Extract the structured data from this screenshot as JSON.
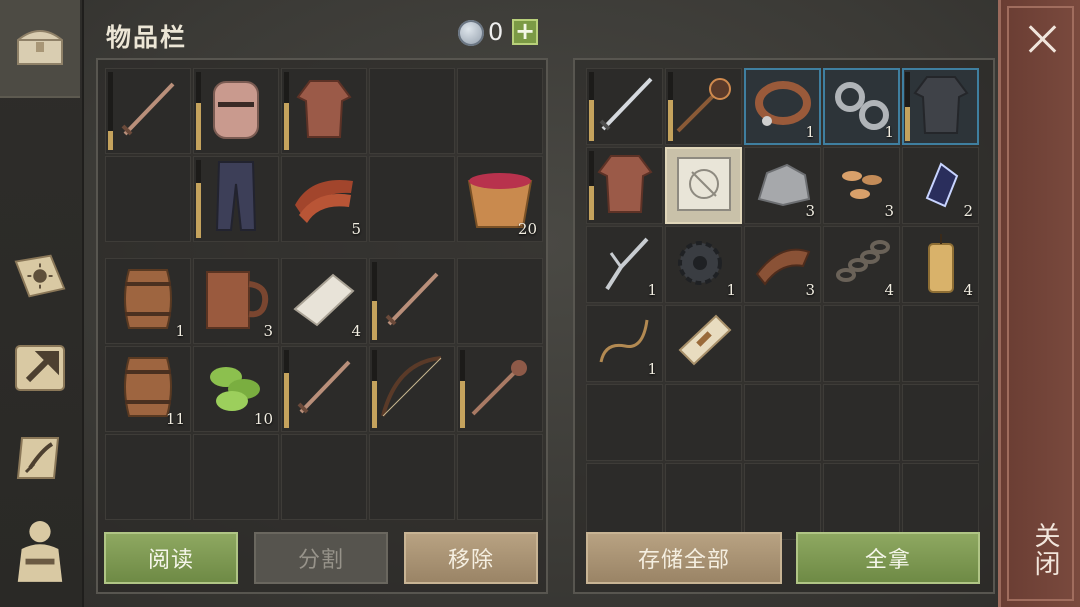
{
  "header": {
    "title": "物品栏",
    "currency": "0",
    "add": "+"
  },
  "inventory": {
    "top": [
      {
        "icon": "sword-icon",
        "qty": "",
        "dur": 0.25
      },
      {
        "icon": "knight-helmet-icon",
        "qty": "",
        "dur": 0.6
      },
      {
        "icon": "chainmail-shirt-icon",
        "qty": "",
        "dur": 0.6
      },
      {
        "icon": "",
        "qty": ""
      },
      {
        "icon": "",
        "qty": ""
      },
      {
        "icon": "",
        "qty": ""
      },
      {
        "icon": "pants-icon",
        "qty": "",
        "dur": 0.7
      },
      {
        "icon": "raw-meat-icon",
        "qty": "5"
      },
      {
        "icon": "",
        "qty": ""
      },
      {
        "icon": "berry-bucket-icon",
        "qty": "20"
      }
    ],
    "bottom": [
      {
        "icon": "barrel-icon",
        "qty": "1"
      },
      {
        "icon": "wooden-mug-icon",
        "qty": "3"
      },
      {
        "icon": "bandage-roll-icon",
        "qty": "4"
      },
      {
        "icon": "sword-icon",
        "qty": "",
        "dur": 0.5
      },
      {
        "icon": "",
        "qty": ""
      },
      {
        "icon": "barrel-icon",
        "qty": "11"
      },
      {
        "icon": "green-herb-icon",
        "qty": "10"
      },
      {
        "icon": "sword-icon",
        "qty": "",
        "dur": 0.7
      },
      {
        "icon": "bow-icon",
        "qty": "",
        "dur": 0.6
      },
      {
        "icon": "mace-icon",
        "qty": "",
        "dur": 0.6
      },
      {
        "icon": "",
        "qty": ""
      },
      {
        "icon": "",
        "qty": ""
      },
      {
        "icon": "",
        "qty": ""
      },
      {
        "icon": "",
        "qty": ""
      },
      {
        "icon": "",
        "qty": ""
      }
    ]
  },
  "storage": [
    {
      "icon": "steel-sword-icon",
      "qty": "",
      "dur": 0.6
    },
    {
      "icon": "spiked-mace-icon",
      "qty": "",
      "dur": 0.6
    },
    {
      "icon": "leather-collar-icon",
      "qty": "1",
      "highlight": true
    },
    {
      "icon": "shackles-icon",
      "qty": "1",
      "highlight": true
    },
    {
      "icon": "plate-armor-icon",
      "qty": "",
      "highlight": true,
      "dur": 0.5
    },
    {
      "icon": "chainmail-shirt-icon",
      "qty": "",
      "dur": 0.5
    },
    {
      "icon": "blueprint-icon",
      "qty": "",
      "selected": true
    },
    {
      "icon": "stone-icon",
      "qty": "3"
    },
    {
      "icon": "seeds-icon",
      "qty": "3"
    },
    {
      "icon": "crystal-icon",
      "qty": "2"
    },
    {
      "icon": "hook-icon",
      "qty": "1"
    },
    {
      "icon": "gear-icon",
      "qty": "1"
    },
    {
      "icon": "leather-icon",
      "qty": "3"
    },
    {
      "icon": "chain-icon",
      "qty": "4"
    },
    {
      "icon": "candle-icon",
      "qty": "4"
    },
    {
      "icon": "rope-icon",
      "qty": "1"
    },
    {
      "icon": "scroll-bundle-icon",
      "qty": ""
    },
    {
      "icon": "",
      "qty": ""
    },
    {
      "icon": "",
      "qty": ""
    },
    {
      "icon": "",
      "qty": ""
    },
    {
      "icon": "",
      "qty": ""
    },
    {
      "icon": "",
      "qty": ""
    },
    {
      "icon": "",
      "qty": ""
    },
    {
      "icon": "",
      "qty": ""
    },
    {
      "icon": "",
      "qty": ""
    },
    {
      "icon": "",
      "qty": ""
    },
    {
      "icon": "",
      "qty": ""
    },
    {
      "icon": "",
      "qty": ""
    },
    {
      "icon": "",
      "qty": ""
    },
    {
      "icon": "",
      "qty": ""
    }
  ],
  "buttons": {
    "read": "阅读",
    "split": "分割",
    "remove": "移除",
    "store_all": "存储全部",
    "take_all": "全拿"
  },
  "close": {
    "label": "关闭"
  },
  "colors": {
    "accent_green": "#7b9a45",
    "durability": "#c5a35d",
    "close_bar": "#6a3d33"
  }
}
